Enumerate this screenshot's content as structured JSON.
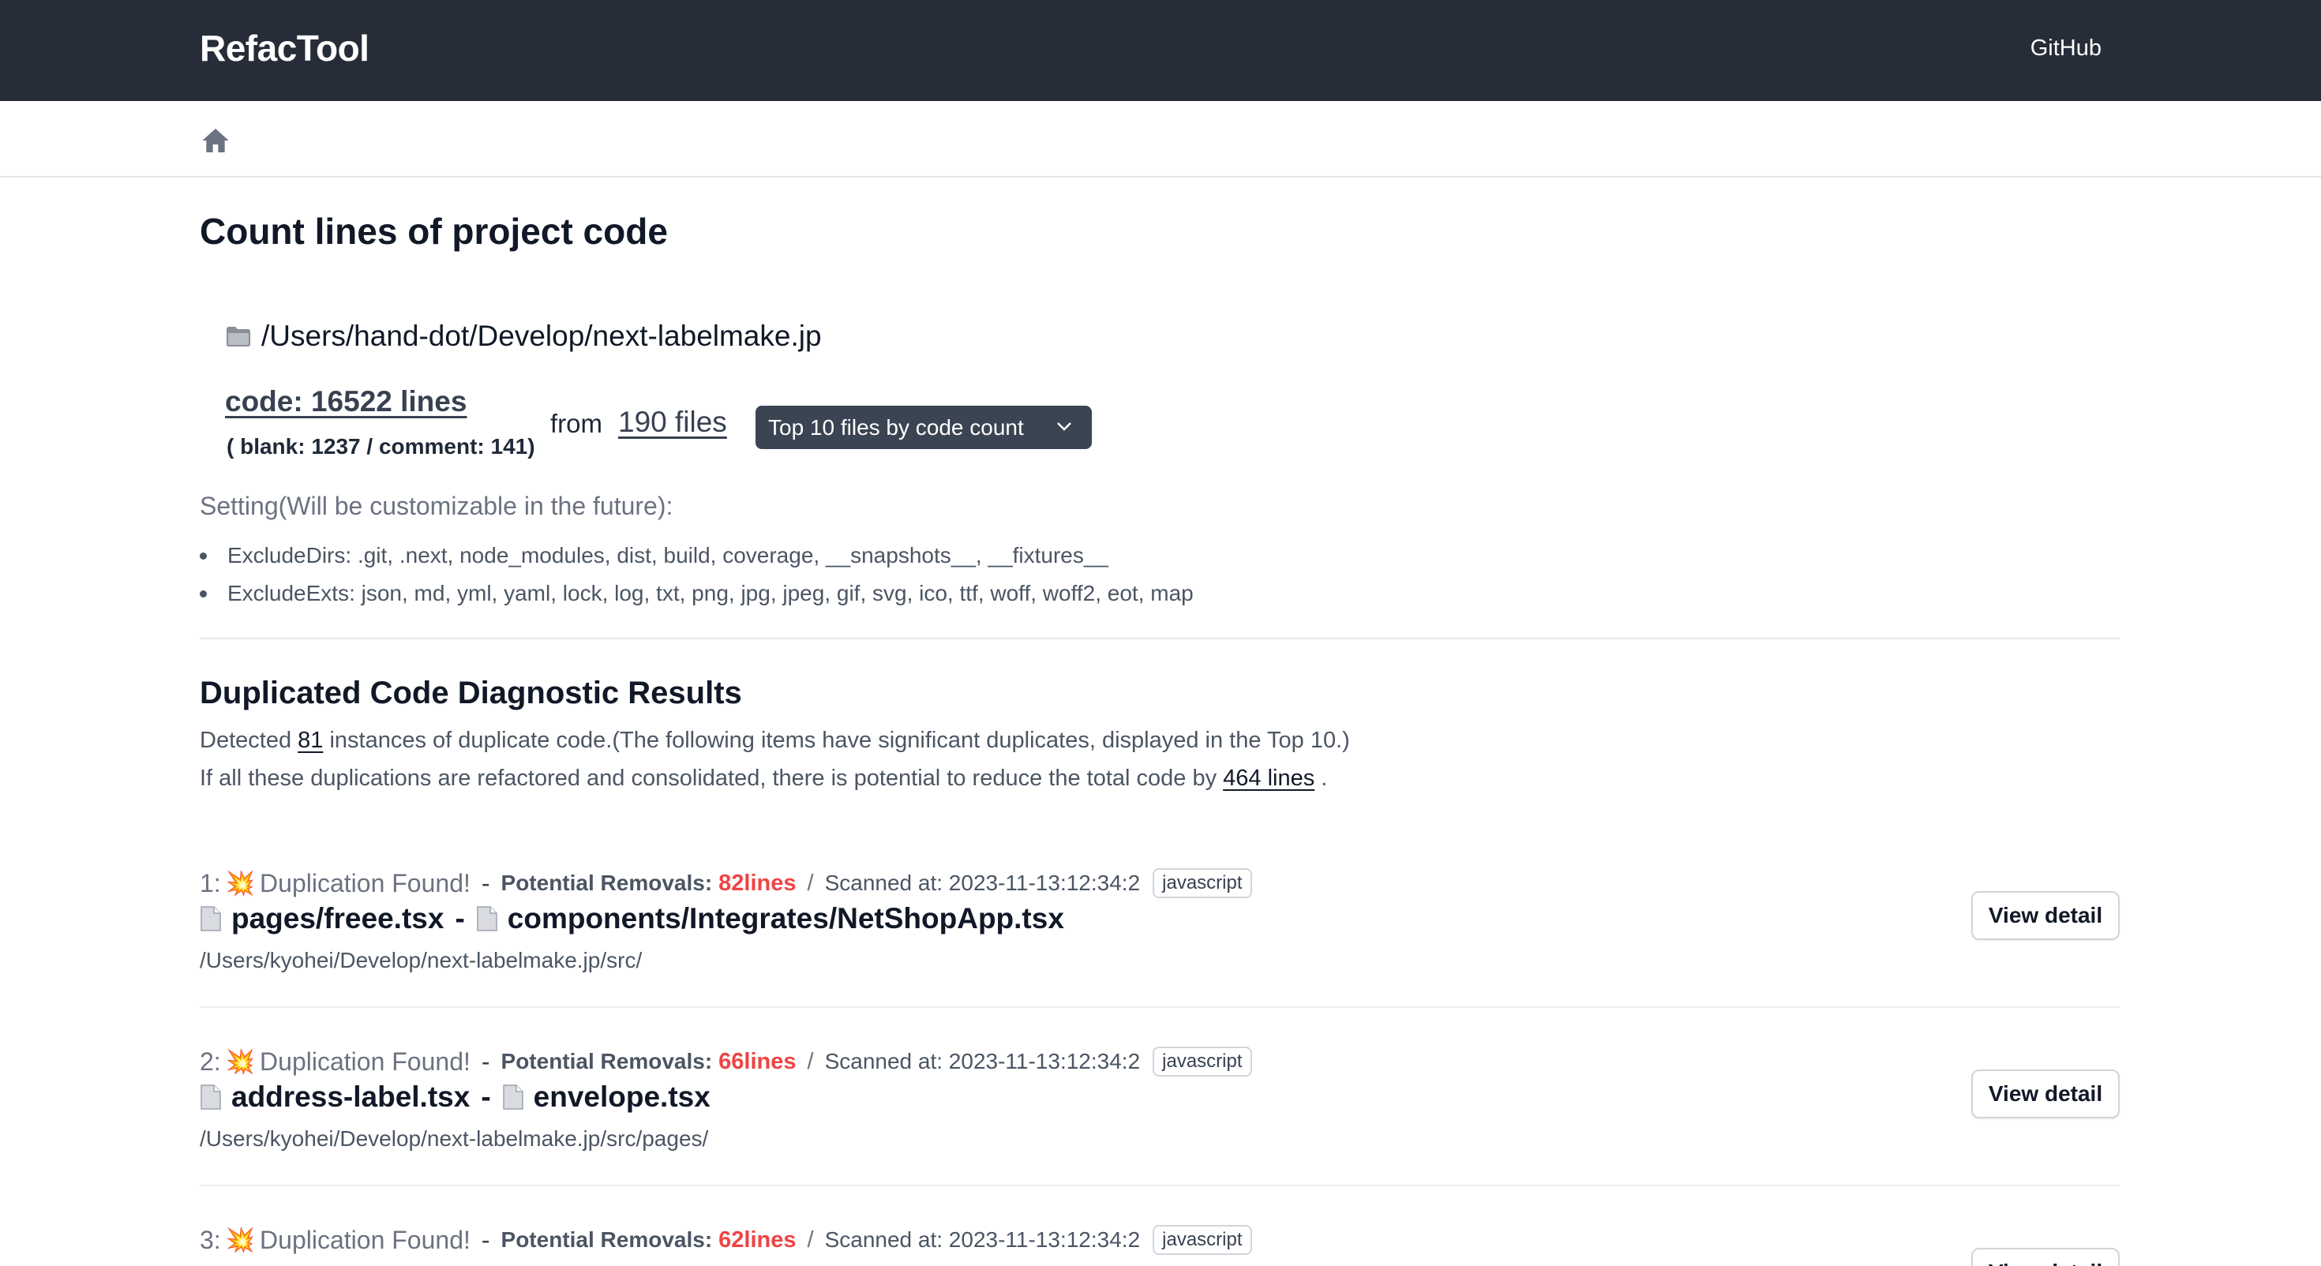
{
  "header": {
    "brand": "RefacTool",
    "github_label": "GitHub"
  },
  "breadcrumb": {
    "home_icon": "home-icon"
  },
  "page": {
    "title": "Count lines of project code"
  },
  "project": {
    "folder_icon": "folder-icon",
    "path": "/Users/hand-dot/Develop/next-labelmake.jp",
    "code_lines_label": "code: 16522 lines",
    "blank_comment": "( blank: 1237 / comment: 141)",
    "from_label": "from",
    "files_label": "190 files",
    "top_files_select": "Top 10 files by code count"
  },
  "settings": {
    "title": "Setting(Will be customizable in the future):",
    "items": [
      "ExcludeDirs: .git, .next, node_modules, dist, build, coverage, __snapshots__, __fixtures__",
      "ExcludeExts: json, md, yml, yaml, lock, log, txt, png, jpg, jpeg, gif, svg, ico, ttf, woff, woff2, eot, map"
    ]
  },
  "duplicates": {
    "title": "Duplicated Code Diagnostic Results",
    "detect_prefix": "Detected",
    "detect_count": "81",
    "detect_suffix": " instances of duplicate code.(The following items have significant duplicates, displayed in the Top 10.)",
    "reduce_prefix": "If all these duplications are refactored and consolidated, there is potential to reduce the total code by",
    "reduce_amount": "464 lines",
    "reduce_suffix": " .",
    "items": [
      {
        "num": "1:",
        "found": "Duplication Found!",
        "dash": "-",
        "removals_label": "Potential Removals:",
        "removals_value": "82lines",
        "slash": "/",
        "scanned": "Scanned at: 2023-11-13:12:34:2",
        "lang": "javascript",
        "file_a": "pages/freee.tsx",
        "file_sep": "-",
        "file_b": "components/Integrates/NetShopApp.tsx",
        "path": "/Users/kyohei/Develop/next-labelmake.jp/src/",
        "button": "View detail"
      },
      {
        "num": "2:",
        "found": "Duplication Found!",
        "dash": "-",
        "removals_label": "Potential Removals:",
        "removals_value": "66lines",
        "slash": "/",
        "scanned": "Scanned at: 2023-11-13:12:34:2",
        "lang": "javascript",
        "file_a": "address-label.tsx",
        "file_sep": "-",
        "file_b": "envelope.tsx",
        "path": "/Users/kyohei/Develop/next-labelmake.jp/src/pages/",
        "button": "View detail"
      },
      {
        "num": "3:",
        "found": "Duplication Found!",
        "dash": "-",
        "removals_label": "Potential Removals:",
        "removals_value": "62lines",
        "slash": "/",
        "scanned": "Scanned at: 2023-11-13:12:34:2",
        "lang": "javascript",
        "button": "View detail"
      }
    ]
  },
  "colors": {
    "topbar": "#262d38",
    "accent_red": "#ef4444",
    "select_bg": "#3b4452"
  }
}
